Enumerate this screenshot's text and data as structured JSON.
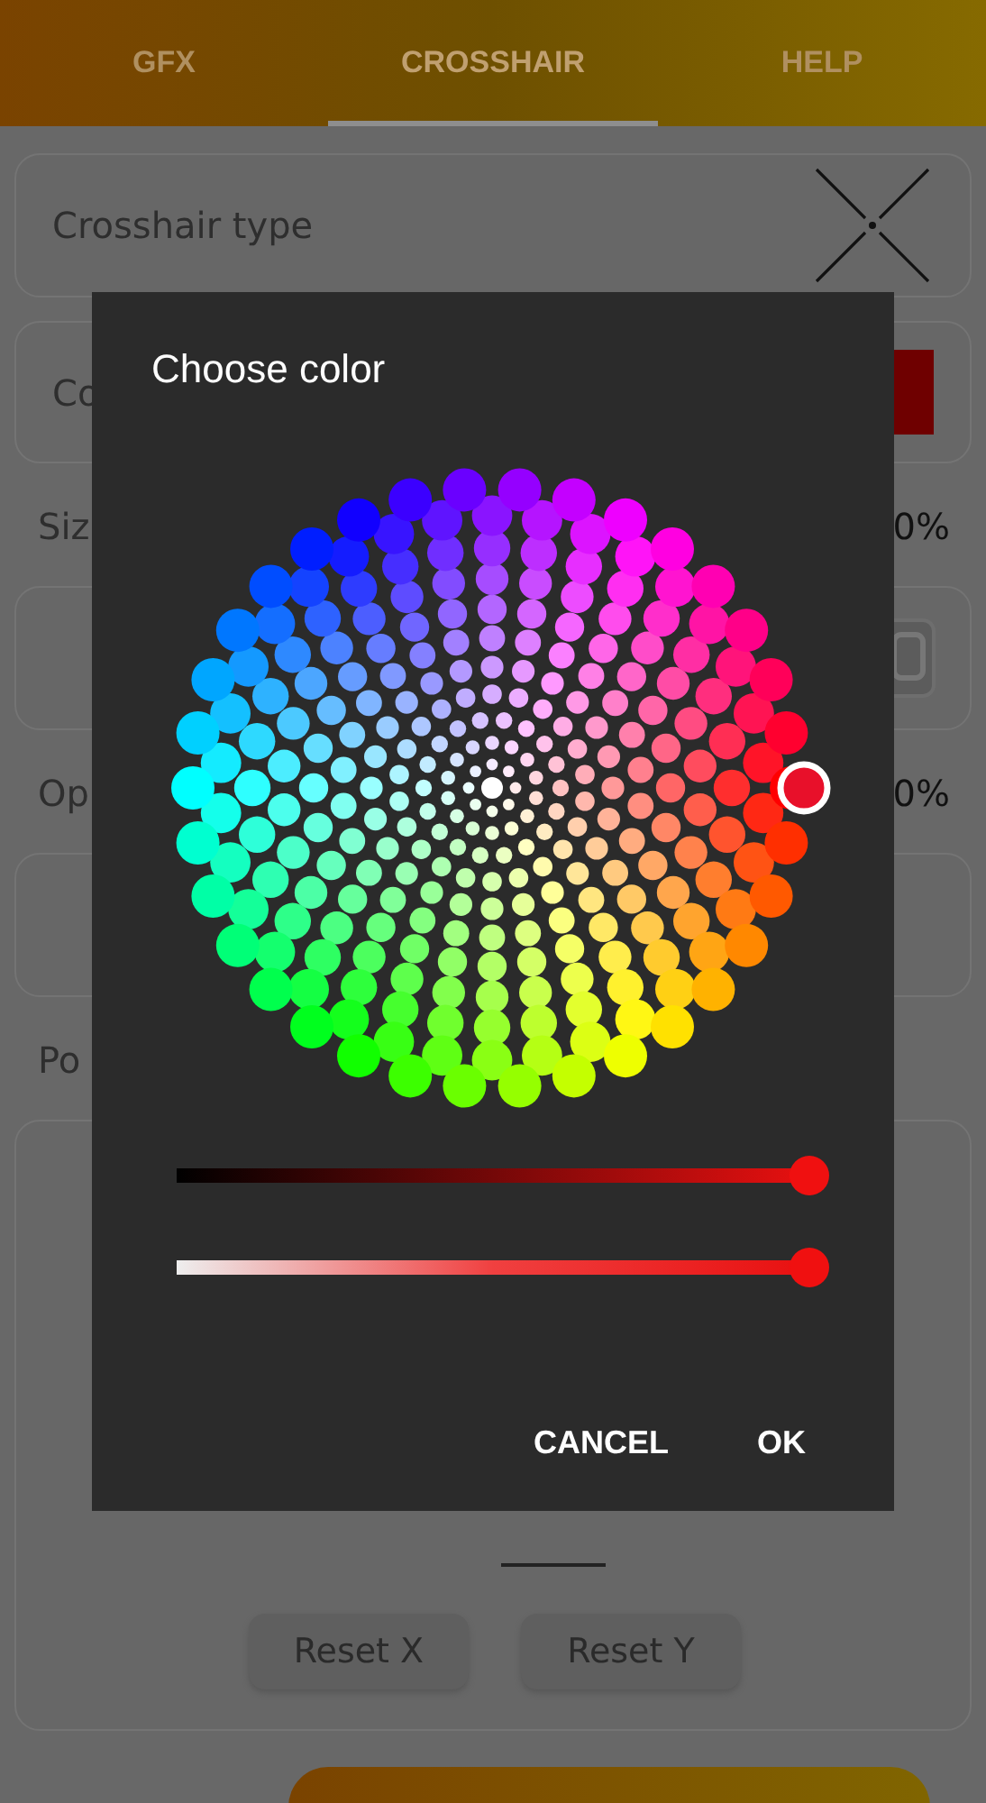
{
  "tabs": [
    {
      "label": "GFX",
      "selected": false
    },
    {
      "label": "CROSSHAIR",
      "selected": true
    },
    {
      "label": "HELP",
      "selected": false
    }
  ],
  "settings": [
    {
      "kind": "crosshair",
      "label": "Crosshair type"
    },
    {
      "kind": "swatch",
      "label": "Co"
    },
    {
      "kind": "heading",
      "label": "Siz",
      "value": "0%"
    },
    {
      "kind": "icon-card"
    },
    {
      "kind": "heading",
      "label": "Op",
      "value": "0%"
    },
    {
      "kind": "blank"
    },
    {
      "kind": "heading",
      "label": "Po"
    },
    {
      "kind": "position",
      "buttons": [
        "Reset X",
        "Reset Y"
      ]
    }
  ],
  "dialog": {
    "title": "Choose color",
    "sliders": [
      {
        "kind": "lightness",
        "level": 1
      },
      {
        "kind": "alpha",
        "level": 1
      }
    ],
    "buttons": [
      "CANCEL",
      "OK"
    ]
  }
}
